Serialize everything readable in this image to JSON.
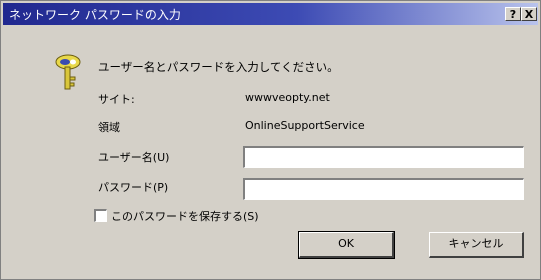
{
  "window": {
    "title": "ネットワーク パスワードの入力",
    "help_label": "?",
    "close_label": "X"
  },
  "dialog": {
    "prompt": "ユーザー名とパスワードを入力してください。",
    "site_label": "サイト:",
    "site_value": "wwwveopty.net",
    "realm_label": "領域",
    "realm_value": "OnlineSupportService",
    "username_label": "ユーザー名(U)",
    "username_value": "",
    "password_label": "パスワード(P)",
    "password_value": "",
    "save_password_label": "このパスワードを保存する(S)",
    "save_password_checked": false
  },
  "buttons": {
    "ok_label": "OK",
    "cancel_label": "キャンセル"
  },
  "icons": {
    "dialog_icon": "key-icon"
  },
  "colors": {
    "titlebar_start": "#20288f",
    "titlebar_end": "#b9c3ec",
    "dialog_bg": "#d4d0c8"
  }
}
